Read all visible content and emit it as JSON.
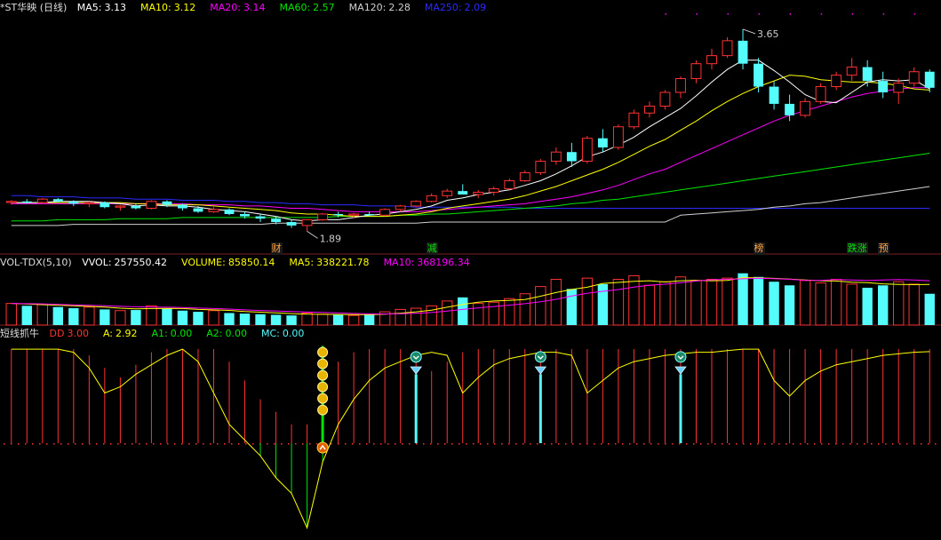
{
  "colors": {
    "up": "#ff3232",
    "down": "#54fcfc",
    "ma5": "#ffffff",
    "ma10": "#ffff00",
    "ma20": "#ff00ff",
    "ma60": "#00e600",
    "ma120": "#d0d0d0",
    "ma250": "#2b2bff",
    "grid_dot": "#ff3232",
    "sep": "#802020",
    "label_red": "#ff3232",
    "label_green": "#00e600",
    "label_orange": "#ffa040"
  },
  "price_panel": {
    "title": "*ST华映 (日线)",
    "ma_labels": [
      {
        "name": "MA5:",
        "value": "3.13",
        "key": "ma5"
      },
      {
        "name": "MA10:",
        "value": "3.12",
        "key": "ma10"
      },
      {
        "name": "MA20:",
        "value": "3.14",
        "key": "ma20"
      },
      {
        "name": "MA60:",
        "value": "2.57",
        "key": "ma60"
      },
      {
        "name": "MA120:",
        "value": "2.28",
        "key": "ma120"
      },
      {
        "name": "MA250:",
        "value": "2.09",
        "key": "ma250"
      }
    ],
    "high_label": "3.65",
    "low_label": "1.89",
    "event_tags": [
      {
        "text": "财",
        "bar": 17,
        "color": "label_orange"
      },
      {
        "text": "减",
        "bar": 27,
        "color": "label_green"
      },
      {
        "text": "榜",
        "bar": 48,
        "color": "label_orange"
      },
      {
        "text": "跌涨",
        "bar": 54,
        "color": "label_green"
      },
      {
        "text": "预",
        "bar": 56,
        "color": "label_orange"
      }
    ]
  },
  "volume_panel": {
    "title": "VOL-TDX(5,10)",
    "labels": [
      {
        "name": "VVOL:",
        "value": "257550.42",
        "key": "ma5"
      },
      {
        "name": "VOLUME:",
        "value": "85850.14",
        "key": "ma10"
      },
      {
        "name": "MA5:",
        "value": "338221.78",
        "key": "ma10"
      },
      {
        "name": "MA10:",
        "value": "368196.34",
        "key": "ma20"
      }
    ]
  },
  "indicator_panel": {
    "title": "短线抓牛",
    "labels": [
      {
        "name": "DD",
        "value": "3.00",
        "key": "label_red"
      },
      {
        "name": "A:",
        "value": "2.92",
        "key": "ma10"
      },
      {
        "name": "A1:",
        "value": "0.00",
        "key": "label_green"
      },
      {
        "name": "A2:",
        "value": "0.00",
        "key": "label_green"
      },
      {
        "name": "MC:",
        "value": "0.00",
        "key": "down"
      }
    ]
  },
  "chart_data": {
    "type": "candlestick",
    "x": "daily bars, left to right",
    "ohlc": [
      [
        2.14,
        2.16,
        2.12,
        2.15
      ],
      [
        2.15,
        2.17,
        2.13,
        2.14
      ],
      [
        2.14,
        2.18,
        2.13,
        2.17
      ],
      [
        2.17,
        2.18,
        2.14,
        2.15
      ],
      [
        2.15,
        2.16,
        2.11,
        2.13
      ],
      [
        2.13,
        2.15,
        2.1,
        2.14
      ],
      [
        2.14,
        2.15,
        2.09,
        2.1
      ],
      [
        2.1,
        2.12,
        2.07,
        2.11
      ],
      [
        2.11,
        2.13,
        2.08,
        2.09
      ],
      [
        2.09,
        2.16,
        2.08,
        2.15
      ],
      [
        2.15,
        2.16,
        2.1,
        2.12
      ],
      [
        2.12,
        2.13,
        2.07,
        2.09
      ],
      [
        2.09,
        2.11,
        2.05,
        2.06
      ],
      [
        2.06,
        2.1,
        2.05,
        2.08
      ],
      [
        2.08,
        2.09,
        2.03,
        2.04
      ],
      [
        2.04,
        2.06,
        2.0,
        2.02
      ],
      [
        2.02,
        2.04,
        1.97,
        2.0
      ],
      [
        2.0,
        2.02,
        1.95,
        1.97
      ],
      [
        1.97,
        1.99,
        1.92,
        1.94
      ],
      [
        1.94,
        1.96,
        1.89,
        1.99
      ],
      [
        1.99,
        2.05,
        1.98,
        2.04
      ],
      [
        2.04,
        2.06,
        2.01,
        2.03
      ],
      [
        2.03,
        2.05,
        2.0,
        2.04
      ],
      [
        2.04,
        2.06,
        2.02,
        2.03
      ],
      [
        2.03,
        2.09,
        2.02,
        2.08
      ],
      [
        2.08,
        2.12,
        2.06,
        2.11
      ],
      [
        2.11,
        2.16,
        2.1,
        2.15
      ],
      [
        2.15,
        2.22,
        2.14,
        2.2
      ],
      [
        2.2,
        2.26,
        2.18,
        2.24
      ],
      [
        2.24,
        2.3,
        2.22,
        2.21
      ],
      [
        2.21,
        2.25,
        2.18,
        2.23
      ],
      [
        2.23,
        2.28,
        2.2,
        2.26
      ],
      [
        2.26,
        2.35,
        2.25,
        2.33
      ],
      [
        2.33,
        2.42,
        2.32,
        2.4
      ],
      [
        2.4,
        2.52,
        2.38,
        2.5
      ],
      [
        2.5,
        2.62,
        2.47,
        2.58
      ],
      [
        2.58,
        2.66,
        2.45,
        2.5
      ],
      [
        2.5,
        2.72,
        2.48,
        2.7
      ],
      [
        2.7,
        2.78,
        2.58,
        2.62
      ],
      [
        2.62,
        2.82,
        2.6,
        2.8
      ],
      [
        2.8,
        2.95,
        2.78,
        2.92
      ],
      [
        2.92,
        3.02,
        2.88,
        2.98
      ],
      [
        2.98,
        3.12,
        2.95,
        3.1
      ],
      [
        3.1,
        3.24,
        3.05,
        3.22
      ],
      [
        3.22,
        3.38,
        3.18,
        3.35
      ],
      [
        3.35,
        3.48,
        3.3,
        3.42
      ],
      [
        3.42,
        3.58,
        3.4,
        3.55
      ],
      [
        3.55,
        3.65,
        3.3,
        3.35
      ],
      [
        3.35,
        3.4,
        3.1,
        3.15
      ],
      [
        3.15,
        3.2,
        2.95,
        3.0
      ],
      [
        3.0,
        3.08,
        2.85,
        2.9
      ],
      [
        2.9,
        3.05,
        2.88,
        3.02
      ],
      [
        3.02,
        3.18,
        3.0,
        3.15
      ],
      [
        3.15,
        3.28,
        3.12,
        3.25
      ],
      [
        3.25,
        3.4,
        3.2,
        3.32
      ],
      [
        3.32,
        3.38,
        3.15,
        3.2
      ],
      [
        3.2,
        3.28,
        3.05,
        3.1
      ],
      [
        3.1,
        3.22,
        3.0,
        3.18
      ],
      [
        3.18,
        3.32,
        3.15,
        3.28
      ],
      [
        3.28,
        3.3,
        3.1,
        3.14
      ]
    ],
    "ma_lines": {
      "ma5": [
        2.14,
        2.14,
        2.14,
        2.15,
        2.15,
        2.15,
        2.14,
        2.13,
        2.11,
        2.12,
        2.11,
        2.11,
        2.1,
        2.08,
        2.07,
        2.06,
        2.04,
        2.02,
        1.99,
        1.98,
        1.99,
        1.99,
        2.01,
        2.03,
        2.04,
        2.06,
        2.08,
        2.11,
        2.16,
        2.18,
        2.21,
        2.23,
        2.25,
        2.29,
        2.33,
        2.39,
        2.46,
        2.54,
        2.58,
        2.64,
        2.71,
        2.8,
        2.88,
        2.96,
        3.07,
        3.19,
        3.3,
        3.38,
        3.38,
        3.29,
        3.19,
        3.08,
        3.02,
        3.01,
        3.1,
        3.19,
        3.21,
        3.2,
        3.21,
        3.13
      ],
      "ma10": [
        2.14,
        2.14,
        2.14,
        2.14,
        2.14,
        2.14,
        2.14,
        2.14,
        2.13,
        2.13,
        2.12,
        2.12,
        2.12,
        2.11,
        2.1,
        2.09,
        2.08,
        2.07,
        2.05,
        2.04,
        2.04,
        2.03,
        2.02,
        2.02,
        2.02,
        2.03,
        2.04,
        2.06,
        2.09,
        2.11,
        2.13,
        2.15,
        2.17,
        2.2,
        2.24,
        2.28,
        2.33,
        2.38,
        2.43,
        2.49,
        2.56,
        2.63,
        2.69,
        2.77,
        2.85,
        2.94,
        3.02,
        3.09,
        3.15,
        3.2,
        3.25,
        3.24,
        3.21,
        3.2,
        3.19,
        3.19,
        3.18,
        3.16,
        3.13,
        3.12
      ],
      "ma20": [
        2.13,
        2.13,
        2.13,
        2.13,
        2.13,
        2.13,
        2.13,
        2.13,
        2.13,
        2.13,
        2.13,
        2.13,
        2.12,
        2.12,
        2.12,
        2.11,
        2.11,
        2.1,
        2.09,
        2.09,
        2.08,
        2.07,
        2.06,
        2.06,
        2.06,
        2.06,
        2.06,
        2.07,
        2.08,
        2.09,
        2.1,
        2.11,
        2.12,
        2.13,
        2.15,
        2.17,
        2.19,
        2.22,
        2.25,
        2.29,
        2.34,
        2.39,
        2.43,
        2.49,
        2.55,
        2.61,
        2.67,
        2.73,
        2.79,
        2.85,
        2.9,
        2.94,
        2.98,
        3.02,
        3.06,
        3.09,
        3.11,
        3.13,
        3.14,
        3.14
      ],
      "ma60": [
        1.98,
        1.98,
        1.98,
        1.99,
        1.99,
        1.99,
        1.99,
        2.0,
        2.0,
        2.0,
        2.0,
        2.01,
        2.01,
        2.01,
        2.01,
        2.01,
        2.01,
        2.01,
        2.01,
        2.01,
        2.01,
        2.02,
        2.02,
        2.02,
        2.02,
        2.03,
        2.03,
        2.04,
        2.04,
        2.05,
        2.06,
        2.07,
        2.08,
        2.09,
        2.1,
        2.11,
        2.13,
        2.14,
        2.16,
        2.17,
        2.19,
        2.21,
        2.23,
        2.25,
        2.27,
        2.29,
        2.31,
        2.33,
        2.35,
        2.37,
        2.39,
        2.41,
        2.43,
        2.45,
        2.47,
        2.49,
        2.51,
        2.53,
        2.55,
        2.57
      ],
      "ma120": [
        1.94,
        1.94,
        1.94,
        1.94,
        1.95,
        1.95,
        1.95,
        1.95,
        1.95,
        1.95,
        1.95,
        1.95,
        1.95,
        1.95,
        1.95,
        1.95,
        1.95,
        1.96,
        1.96,
        1.96,
        1.96,
        1.96,
        1.96,
        1.96,
        1.96,
        1.96,
        1.96,
        1.97,
        1.97,
        1.97,
        1.97,
        1.97,
        1.97,
        1.97,
        1.97,
        1.97,
        1.97,
        1.97,
        1.97,
        1.97,
        1.97,
        1.97,
        1.97,
        2.03,
        2.04,
        2.05,
        2.06,
        2.07,
        2.08,
        2.1,
        2.11,
        2.13,
        2.14,
        2.16,
        2.18,
        2.2,
        2.22,
        2.24,
        2.26,
        2.28
      ],
      "ma250": [
        2.2,
        2.2,
        2.19,
        2.19,
        2.19,
        2.18,
        2.18,
        2.18,
        2.17,
        2.17,
        2.17,
        2.16,
        2.16,
        2.16,
        2.15,
        2.15,
        2.14,
        2.14,
        2.13,
        2.13,
        2.12,
        2.12,
        2.12,
        2.11,
        2.11,
        2.11,
        2.1,
        2.1,
        2.1,
        2.1,
        2.1,
        2.1,
        2.1,
        2.09,
        2.09,
        2.09,
        2.09,
        2.09,
        2.09,
        2.09,
        2.09,
        2.09,
        2.09,
        2.09,
        2.09,
        2.09,
        2.09,
        2.09,
        2.09,
        2.09,
        2.09,
        2.09,
        2.09,
        2.09,
        2.09,
        2.09,
        2.09,
        2.09,
        2.09,
        2.09
      ]
    },
    "volume": [
      180,
      160,
      170,
      150,
      140,
      150,
      130,
      120,
      125,
      160,
      140,
      120,
      110,
      120,
      100,
      95,
      90,
      85,
      80,
      100,
      90,
      85,
      80,
      90,
      110,
      130,
      140,
      160,
      200,
      230,
      180,
      190,
      220,
      260,
      320,
      380,
      300,
      390,
      340,
      380,
      410,
      330,
      360,
      400,
      370,
      380,
      390,
      430,
      400,
      360,
      330,
      370,
      350,
      380,
      340,
      310,
      330,
      360,
      340,
      260
    ],
    "volume_ma5": [
      180,
      175,
      170,
      165,
      160,
      155,
      150,
      140,
      135,
      137,
      139,
      137,
      130,
      126,
      122,
      113,
      107,
      102,
      95,
      90,
      89,
      88,
      86,
      87,
      91,
      99,
      110,
      124,
      148,
      172,
      190,
      200,
      204,
      212,
      240,
      270,
      296,
      314,
      346,
      354,
      364,
      368,
      358,
      368,
      372,
      368,
      370,
      394,
      392,
      388,
      382,
      374,
      368,
      366,
      356,
      352,
      342,
      338,
      336,
      338
    ],
    "volume_ma10": [
      180,
      178,
      176,
      172,
      168,
      164,
      160,
      156,
      152,
      150,
      148,
      146,
      141,
      137,
      133,
      126,
      121,
      117,
      112,
      108,
      105,
      100,
      96,
      93,
      92,
      94,
      98,
      104,
      116,
      130,
      143,
      154,
      165,
      178,
      194,
      214,
      241,
      264,
      280,
      295,
      316,
      331,
      339,
      351,
      366,
      376,
      380,
      384,
      389,
      385,
      380,
      372,
      371,
      378,
      375,
      370,
      374,
      378,
      374,
      368
    ],
    "indicator_dd": [
      3.0,
      3.0,
      3.0,
      3.0,
      3.0,
      2.8,
      2.4,
      2.1,
      2.5,
      2.9,
      3.0,
      3.0,
      3.0,
      3.0,
      2.6,
      2.0,
      1.4,
      1.0,
      0.6,
      0.6,
      2.0,
      2.6,
      2.9,
      3.0,
      3.0,
      3.0,
      2.8,
      2.3,
      2.6,
      2.9,
      3.0,
      3.0,
      3.0,
      3.0,
      3.0,
      3.0,
      3.0,
      3.0,
      3.0,
      3.0,
      3.0,
      3.0,
      3.0,
      3.0,
      3.0,
      3.0,
      3.0,
      3.0,
      3.0,
      3.0,
      3.0,
      3.0,
      3.0,
      3.0,
      3.0,
      3.0,
      3.0,
      3.0,
      3.0,
      3.0
    ],
    "indicator_a": [
      3.0,
      3.0,
      3.0,
      3.0,
      2.9,
      2.4,
      1.6,
      1.8,
      2.2,
      2.5,
      2.8,
      3.0,
      2.6,
      1.6,
      0.6,
      0.1,
      -0.4,
      -1.1,
      -1.6,
      -2.7,
      -0.6,
      0.6,
      1.4,
      2.0,
      2.4,
      2.6,
      2.8,
      2.9,
      2.8,
      1.6,
      2.1,
      2.5,
      2.7,
      2.8,
      2.9,
      2.9,
      2.8,
      1.6,
      2.0,
      2.4,
      2.6,
      2.7,
      2.8,
      2.85,
      2.9,
      2.9,
      2.95,
      3.0,
      3.0,
      2.0,
      1.5,
      2.0,
      2.3,
      2.5,
      2.6,
      2.7,
      2.8,
      2.85,
      2.9,
      2.92
    ],
    "signals": {
      "bull_stack_bar": 20,
      "arrow_bar": 20,
      "diamond_bars": [
        26,
        34,
        43
      ]
    },
    "ylim_price": [
      1.8,
      3.75
    ],
    "ylim_volume": [
      0,
      450
    ],
    "ylim_indicator": [
      -3.0,
      3.2
    ]
  }
}
